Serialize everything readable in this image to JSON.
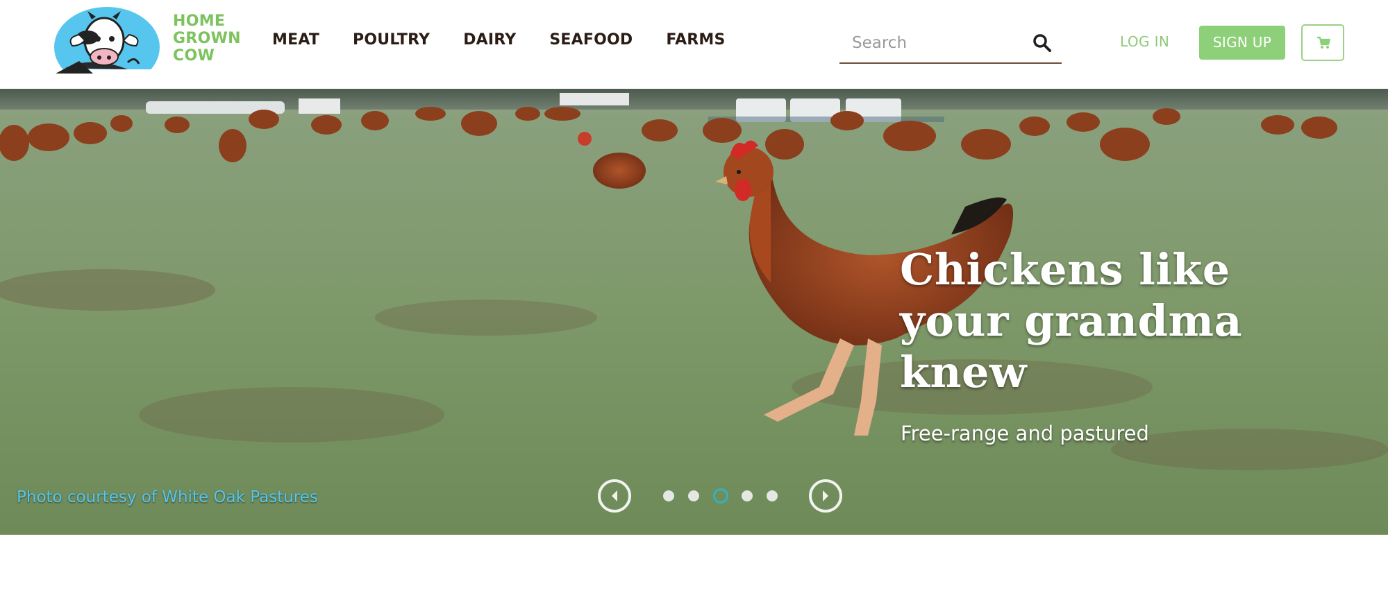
{
  "brand": {
    "logo_lines": [
      "HOME",
      "GROWN",
      "COW"
    ],
    "brand_color": "#7cc35d"
  },
  "nav": {
    "items": [
      {
        "label": "MEAT"
      },
      {
        "label": "POULTRY"
      },
      {
        "label": "DAIRY"
      },
      {
        "label": "SEAFOOD"
      },
      {
        "label": "FARMS"
      }
    ]
  },
  "search": {
    "placeholder": "Search",
    "icon": "search-icon"
  },
  "account": {
    "login_label": "LOG IN",
    "signup_label": "SIGN UP",
    "cart_icon": "cart-icon",
    "accent_color": "#8ed07a"
  },
  "hero": {
    "headline": "Chickens like your grandma knew",
    "subhead": "Free-range and pastured",
    "credit": "Photo courtesy of White Oak Pastures",
    "carousel": {
      "slide_count": 5,
      "active_index": 2,
      "prev_icon": "chevron-left-icon",
      "next_icon": "chevron-right-icon",
      "active_color": "#2fb5c9"
    }
  }
}
